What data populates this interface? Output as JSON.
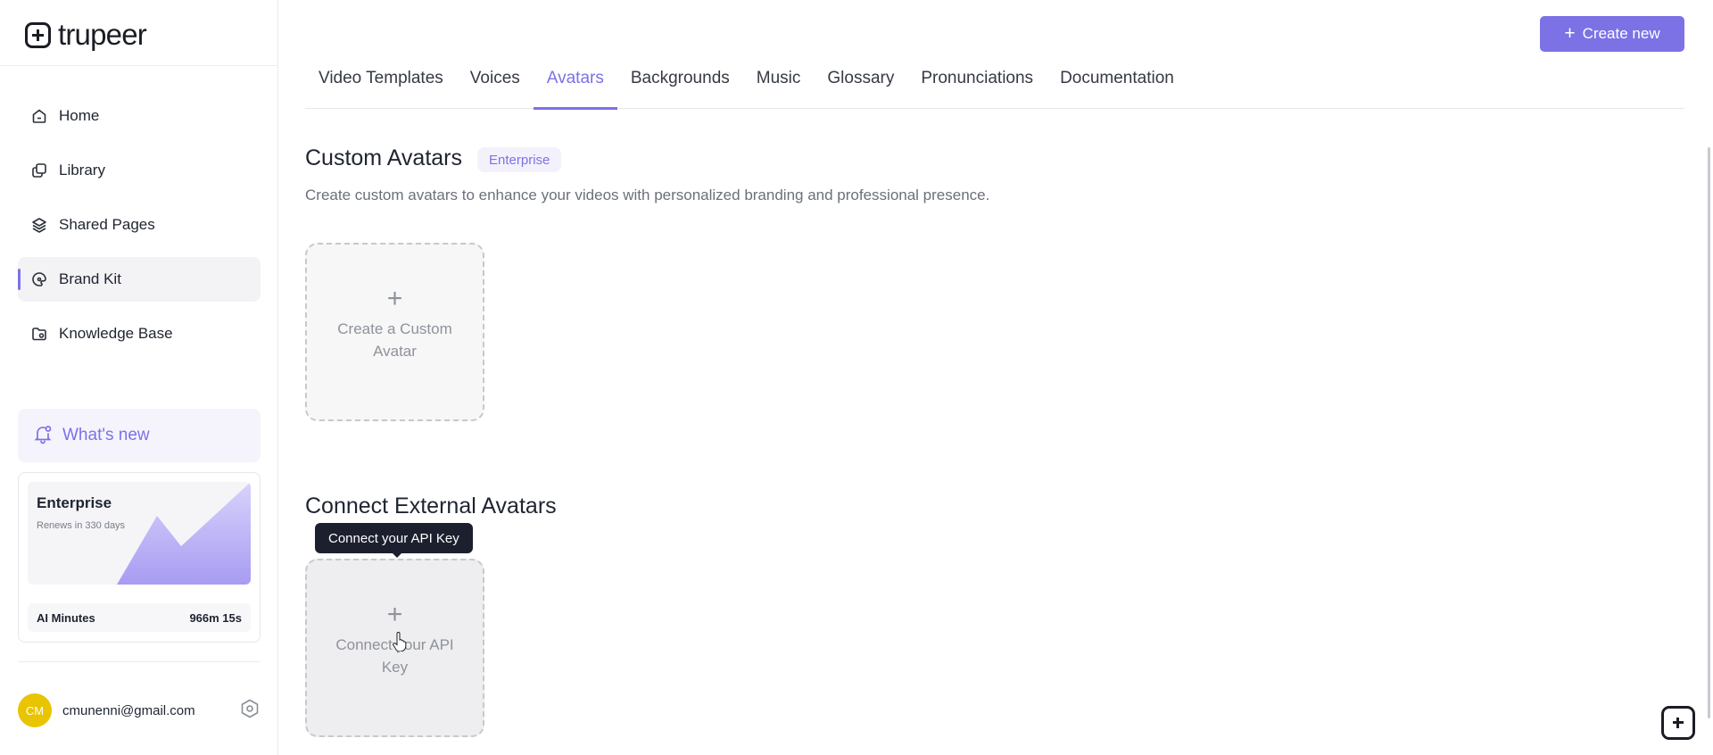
{
  "app": {
    "logo_text": "trupeer"
  },
  "sidebar": {
    "items": [
      {
        "label": "Home",
        "icon": "home-icon",
        "active": false
      },
      {
        "label": "Library",
        "icon": "library-icon",
        "active": false
      },
      {
        "label": "Shared Pages",
        "icon": "layers-icon",
        "active": false
      },
      {
        "label": "Brand Kit",
        "icon": "brand-kit-icon",
        "active": true
      },
      {
        "label": "Knowledge Base",
        "icon": "folder-icon",
        "active": false
      }
    ],
    "whats_new": {
      "label": "What's new",
      "icon": "bell-icon"
    },
    "plan": {
      "name": "Enterprise",
      "renewal": "Renews in 330 days",
      "minutes_label": "AI Minutes",
      "minutes_value": "966m 15s"
    },
    "user": {
      "initials": "CM",
      "email": "cmunenni@gmail.com",
      "settings_icon": "settings-icon"
    }
  },
  "header": {
    "create_button": "Create new"
  },
  "tabs": [
    {
      "label": "Video Templates",
      "active": false
    },
    {
      "label": "Voices",
      "active": false
    },
    {
      "label": "Avatars",
      "active": true
    },
    {
      "label": "Backgrounds",
      "active": false
    },
    {
      "label": "Music",
      "active": false
    },
    {
      "label": "Glossary",
      "active": false
    },
    {
      "label": "Pronunciations",
      "active": false
    },
    {
      "label": "Documentation",
      "active": false
    }
  ],
  "custom_avatars": {
    "title": "Custom Avatars",
    "badge": "Enterprise",
    "description": "Create custom avatars to enhance your videos with personalized branding and professional presence.",
    "card_plus": "+",
    "card_label": "Create a Custom Avatar"
  },
  "external_avatars": {
    "title": "Connect External Avatars",
    "tooltip": "Connect your API Key",
    "card_plus": "+",
    "card_label": "Connect your API Key"
  },
  "colors": {
    "accent": "#7c72e6",
    "tooltip_bg": "#1c1f2e",
    "avatar_bg": "#e9c400"
  }
}
